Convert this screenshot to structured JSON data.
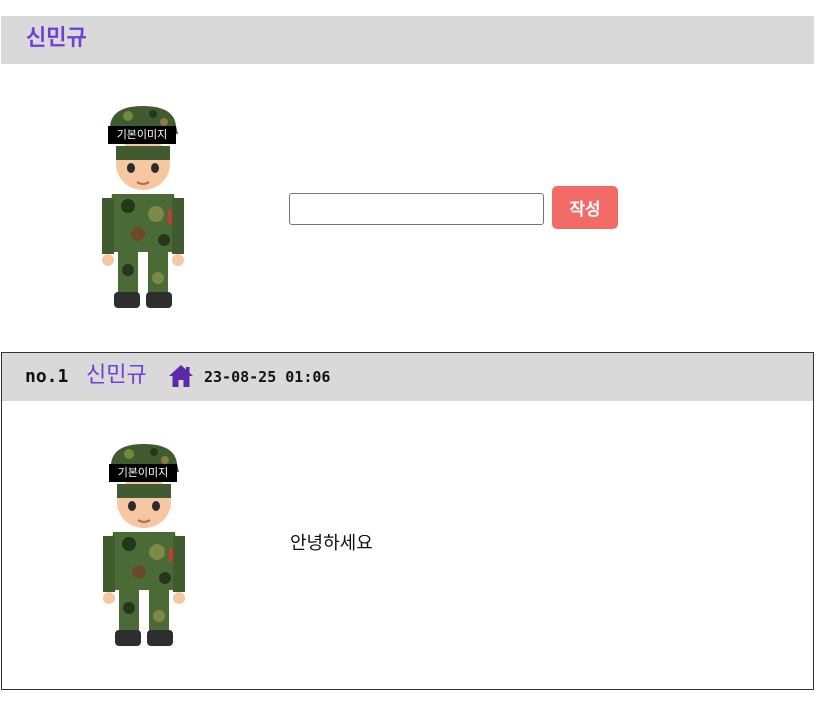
{
  "header": {
    "username": "신민규"
  },
  "composer": {
    "avatar_label": "기본이미지",
    "input_value": "",
    "submit_label": "작성"
  },
  "posts": [
    {
      "number": "no.1",
      "author": "신민규",
      "icon": "home-icon",
      "date": "23-08-25 01:06",
      "avatar_label": "기본이미지",
      "body": "안녕하세요"
    }
  ],
  "colors": {
    "accent_purple": "#6f3fd6",
    "submit_red": "#f26b66",
    "header_gray": "#d9d9d9"
  }
}
